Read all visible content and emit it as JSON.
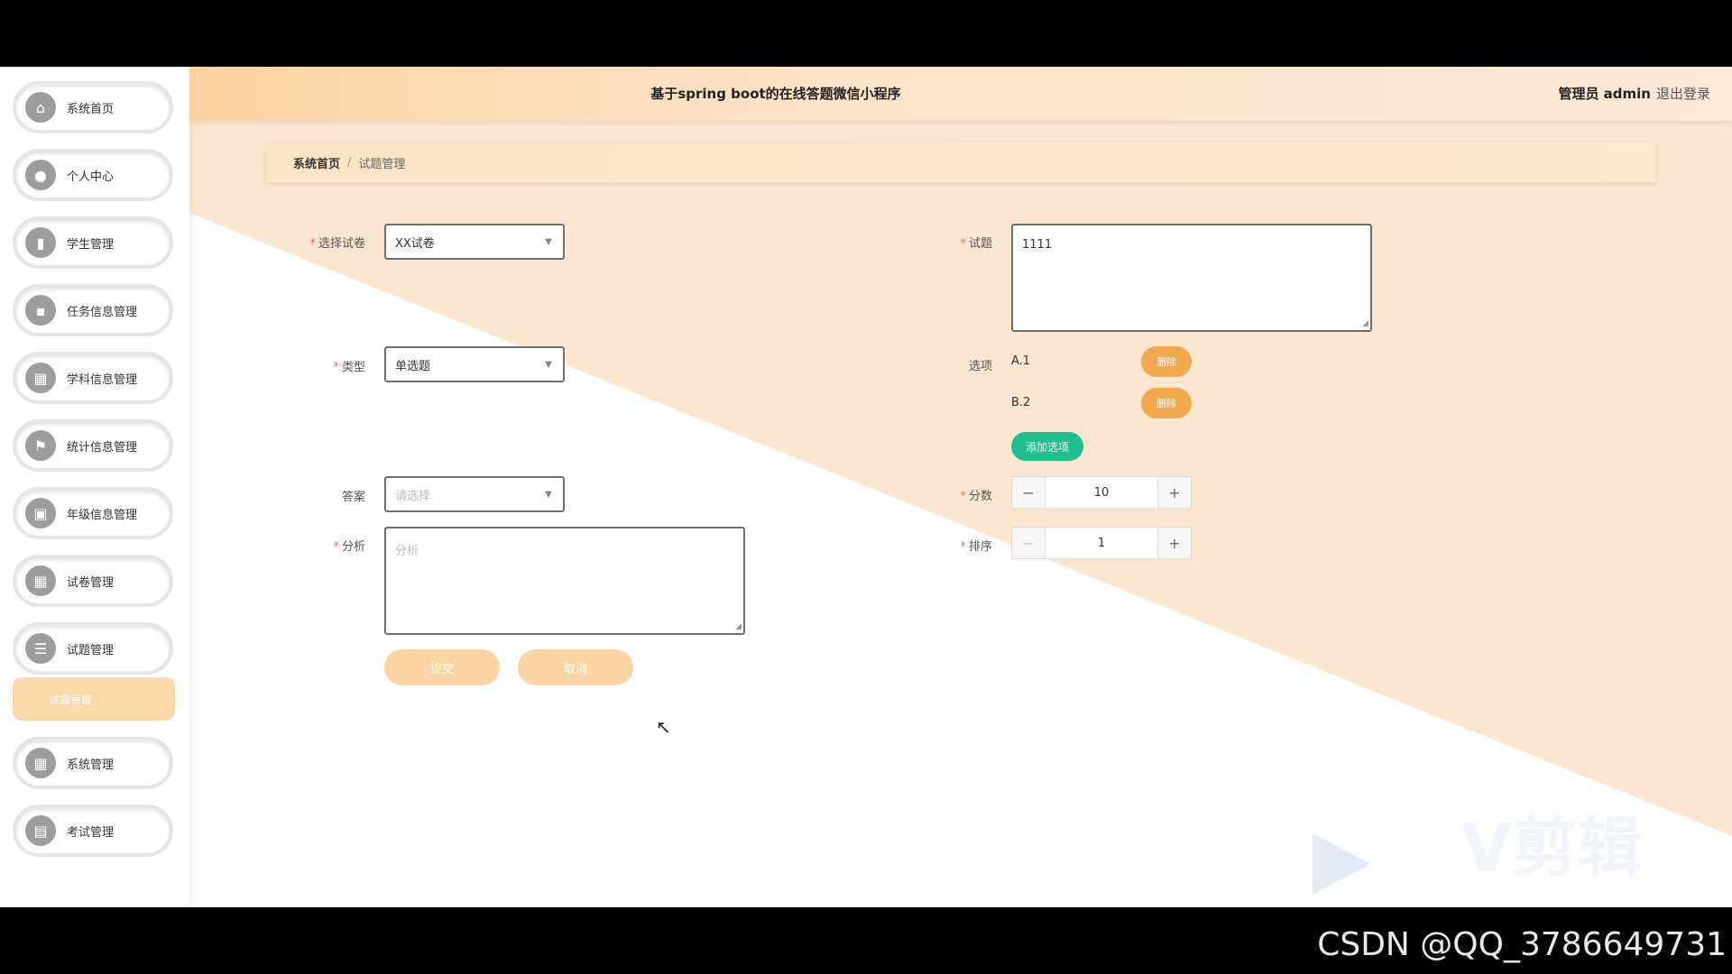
{
  "header": {
    "title": "基于spring boot的在线答题微信小程序",
    "user": "管理员 admin",
    "logout": "退出登录"
  },
  "sidebar": {
    "items": [
      {
        "label": "系统首页",
        "icon": "home-icon",
        "glyph": "⌂"
      },
      {
        "label": "个人中心",
        "icon": "user-icon",
        "glyph": "●"
      },
      {
        "label": "学生管理",
        "icon": "book-icon",
        "glyph": "▮"
      },
      {
        "label": "任务信息管理",
        "icon": "message-icon",
        "glyph": "▪"
      },
      {
        "label": "学科信息管理",
        "icon": "grid-icon",
        "glyph": "▦"
      },
      {
        "label": "统计信息管理",
        "icon": "flag-icon",
        "glyph": "⚑"
      },
      {
        "label": "年级信息管理",
        "icon": "document-icon",
        "glyph": "▣"
      },
      {
        "label": "试卷管理",
        "icon": "grid-icon",
        "glyph": "▦"
      },
      {
        "label": "试题管理",
        "icon": "sliders-icon",
        "glyph": "☰"
      },
      {
        "label": "系统管理",
        "icon": "grid-icon",
        "glyph": "▦"
      },
      {
        "label": "考试管理",
        "icon": "table-icon",
        "glyph": "▤"
      }
    ],
    "sub_item": "试题管理"
  },
  "breadcrumb": {
    "home": "系统首页",
    "separator": "/",
    "current": "试题管理"
  },
  "form": {
    "paper_label": "选择试卷",
    "paper_value": "XX试卷",
    "type_label": "类型",
    "type_value": "单选题",
    "answer_label": "答案",
    "answer_placeholder": "请选择",
    "analysis_label": "分析",
    "analysis_placeholder": "分析",
    "question_label": "试题",
    "question_value": "1111",
    "options_label": "选项",
    "options": [
      {
        "text": "A.1",
        "delete_label": "删除"
      },
      {
        "text": "B.2",
        "delete_label": "删除"
      }
    ],
    "add_option_label": "添加选项",
    "score_label": "分数",
    "score_value": "10",
    "order_label": "排序",
    "order_value": "1",
    "submit_label": "提交",
    "cancel_label": "取消"
  },
  "watermark": "V剪辑",
  "footer_credit": "CSDN @QQ_3786649731",
  "colors": {
    "accent": "#fcd4a4",
    "delete": "#f0a94e",
    "add": "#1fbf8f",
    "required": "#f56c6c"
  }
}
